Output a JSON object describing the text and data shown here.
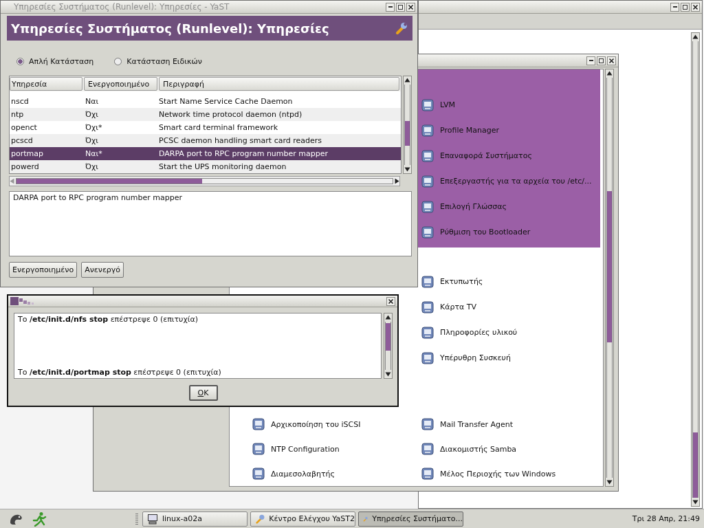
{
  "control_center": {
    "sections": [
      {
        "selected": true,
        "rows": [
          {
            "right": {
              "label": "LVM"
            }
          },
          {
            "right": {
              "label": "Profile Manager"
            }
          },
          {
            "right": {
              "label": "Επαναφορά Συστήματος"
            }
          },
          {
            "right": {
              "label": "Επεξεργαστής για τα αρχεία του /etc/..."
            }
          },
          {
            "right": {
              "label": "Επιλογή Γλώσσας"
            }
          },
          {
            "right": {
              "label": "Ρύθμιση του Bootloader"
            }
          }
        ]
      },
      {
        "selected": false,
        "rows": [
          {
            "right": {
              "label": "Εκτυπωτής"
            }
          },
          {
            "right": {
              "label": "Κάρτα TV"
            }
          },
          {
            "right": {
              "label": "Πληροφορίες υλικού"
            }
          },
          {
            "right": {
              "label": "Υπέρυθρη Συσκευή"
            }
          }
        ]
      },
      {
        "selected": false,
        "rows": [
          {
            "left": {
              "label": "Αρχικοποίηση του iSCSI"
            },
            "right": {
              "label": "Mail Transfer Agent"
            }
          },
          {
            "left": {
              "label": "NTP Configuration"
            },
            "right": {
              "label": "Διακομιστής Samba"
            }
          },
          {
            "left": {
              "label": "Διαμεσολαβητής"
            },
            "right": {
              "label": "Μέλος Περιοχής των Windows"
            }
          }
        ]
      }
    ]
  },
  "services_window": {
    "title": "Υπηρεσίες Συστήματος (Runlevel): Υπηρεσίες - YaST",
    "header": "Υπηρεσίες Συστήματος (Runlevel): Υπηρεσίες",
    "modes": [
      {
        "label": "Απλή Κατάσταση",
        "selected": true
      },
      {
        "label": "Κατάσταση Ειδικών",
        "selected": false
      }
    ],
    "table": {
      "columns": [
        "Υπηρεσία",
        "Ενεργοποιημένο",
        "Περιγραφή"
      ],
      "rows": [
        {
          "cells": [
            "nscd",
            "Ναι",
            "Start Name Service Cache Daemon"
          ],
          "selected": false
        },
        {
          "cells": [
            "ntp",
            "Όχι",
            "Network time protocol daemon (ntpd)"
          ],
          "selected": false
        },
        {
          "cells": [
            "openct",
            "Όχι*",
            "Smart card terminal framework"
          ],
          "selected": false
        },
        {
          "cells": [
            "pcscd",
            "Όχι",
            "PCSC daemon handling smart card readers"
          ],
          "selected": false
        },
        {
          "cells": [
            "portmap",
            "Ναι*",
            "DARPA port to RPC program number mapper"
          ],
          "selected": true
        },
        {
          "cells": [
            "powerd",
            "Όχι",
            "Start the UPS monitoring daemon"
          ],
          "selected": false
        }
      ]
    },
    "description": "DARPA port to RPC program number mapper",
    "buttons": [
      "Ενεργοποιημένο",
      "Ανενεργό"
    ]
  },
  "dialog": {
    "lines": [
      "Το **/etc/init.d/nfs stop** επέστρεψε 0 (επιτυχία)",
      "Το **/etc/init.d/portmap stop** επέστρεψε 0 (επιτυχία)"
    ],
    "button": "OK"
  },
  "taskbar": {
    "tasks": [
      {
        "label": "linux-a02a",
        "selected": false
      },
      {
        "label": "Κέντρο Ελέγχου YaST2",
        "selected": false
      },
      {
        "label": "Υπηρεσίες Συστήματο...",
        "selected": true
      }
    ],
    "clock": "Τρι 28 Απρ, 21:49"
  }
}
